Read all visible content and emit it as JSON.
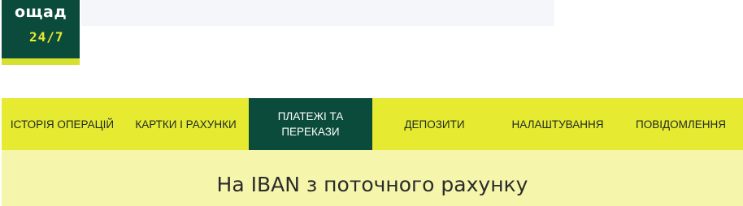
{
  "logo": {
    "name": "ощад",
    "tagline": "24/7"
  },
  "nav": {
    "tabs": [
      {
        "label": "ІСТОРІЯ ОПЕРАЦІЙ",
        "active": false
      },
      {
        "label": "КАРТКИ І РАХУНКИ",
        "active": false
      },
      {
        "label": "ПЛАТЕЖІ ТА ПЕРЕКАЗИ",
        "active": true
      },
      {
        "label": "ДЕПОЗИТИ",
        "active": false
      },
      {
        "label": "НАЛАШТУВАННЯ",
        "active": false
      },
      {
        "label": "ПОВІДОМЛЕННЯ",
        "active": false
      }
    ]
  },
  "page": {
    "title": "На IBAN з поточного рахунку"
  },
  "colors": {
    "brand_green": "#0b4b3b",
    "brand_yellow": "#e6ea31",
    "banner_yellow": "#f5f6ac"
  }
}
